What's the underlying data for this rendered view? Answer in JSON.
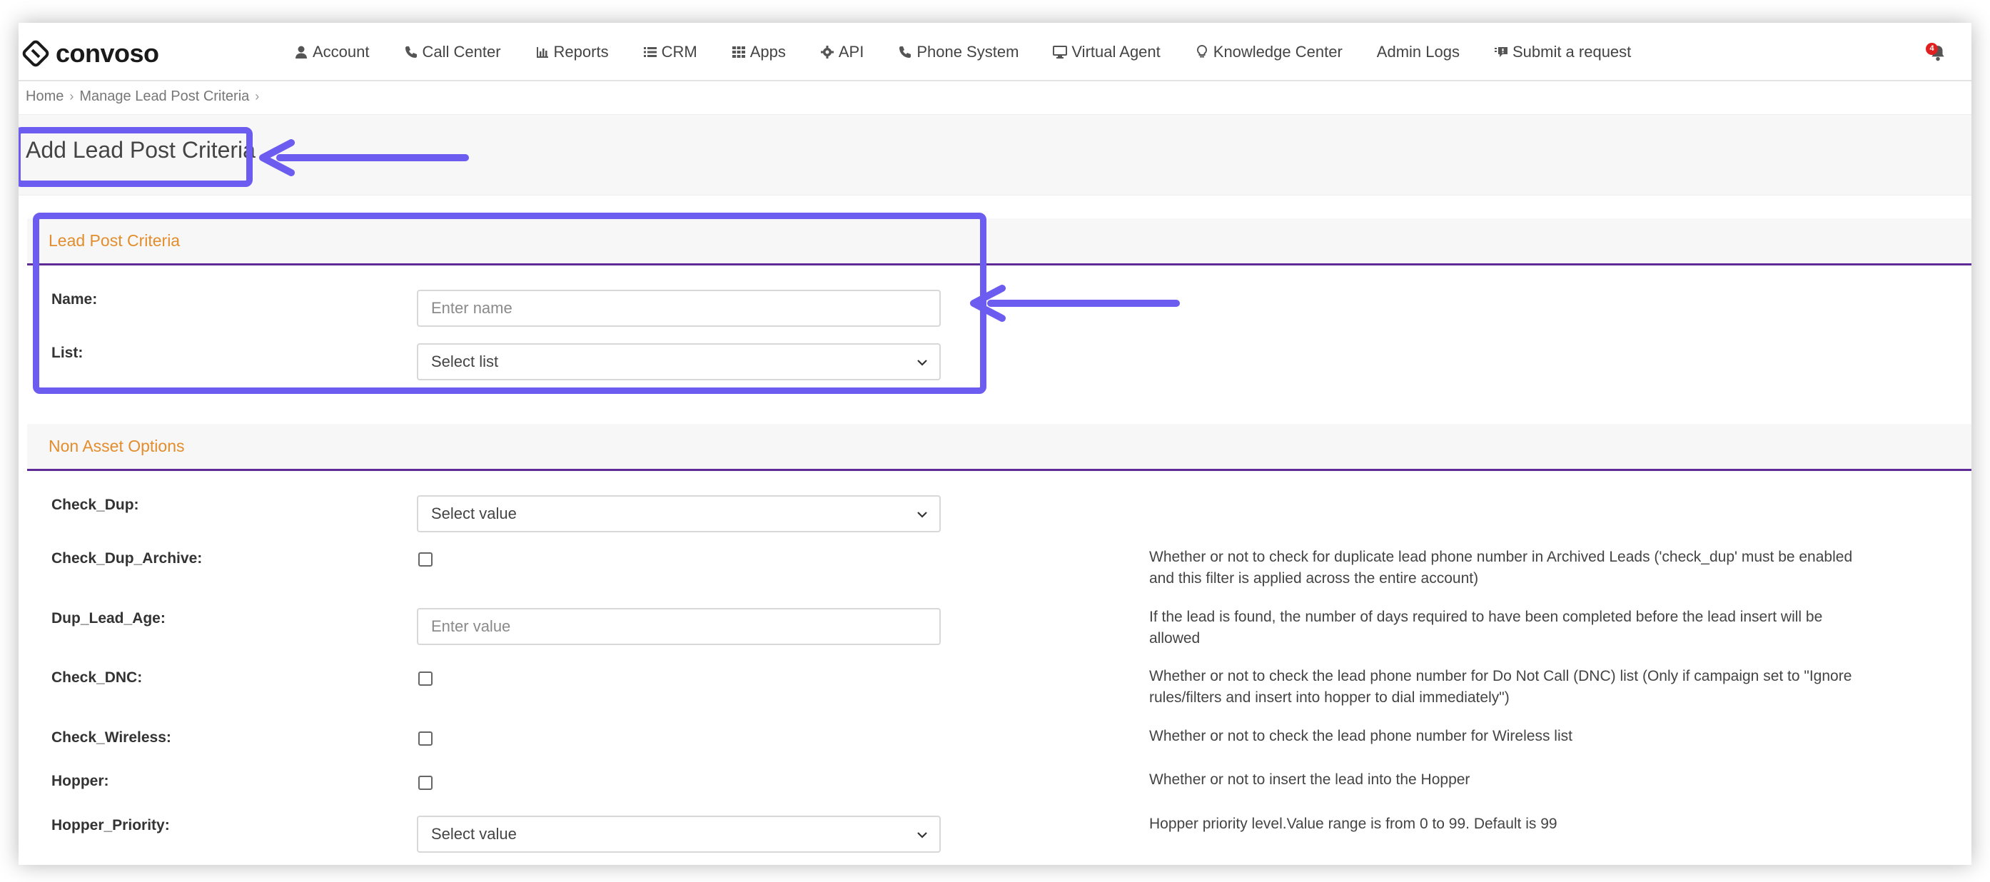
{
  "brand": {
    "name": "convoso"
  },
  "nav": [
    {
      "label": "Account",
      "icon": "user-icon"
    },
    {
      "label": "Call Center",
      "icon": "phone-icon"
    },
    {
      "label": "Reports",
      "icon": "bar-chart-icon"
    },
    {
      "label": "CRM",
      "icon": "list-icon"
    },
    {
      "label": "Apps",
      "icon": "grid-icon"
    },
    {
      "label": "API",
      "icon": "gear-icon"
    },
    {
      "label": "Phone System",
      "icon": "phone-icon"
    },
    {
      "label": "Virtual Agent",
      "icon": "monitor-icon"
    },
    {
      "label": "Knowledge Center",
      "icon": "lightbulb-icon"
    },
    {
      "label": "Admin Logs",
      "icon": ""
    },
    {
      "label": "Submit a request",
      "icon": "chat-icon"
    }
  ],
  "notification": {
    "count": "4"
  },
  "breadcrumb": {
    "home": "Home",
    "current": "Manage Lead Post Criteria"
  },
  "page": {
    "title": "Add Lead Post Criteria"
  },
  "section1": {
    "title": "Lead Post Criteria",
    "name_label": "Name:",
    "name_placeholder": "Enter name",
    "list_label": "List:",
    "list_value": "Select list"
  },
  "section2": {
    "title": "Non Asset Options",
    "fields": [
      {
        "label": "Check_Dup:",
        "type": "select",
        "value": "Select value",
        "desc": ""
      },
      {
        "label": "Check_Dup_Archive:",
        "type": "checkbox",
        "value": "",
        "desc": "Whether or not to check for duplicate lead phone number in Archived Leads ('check_dup' must be enabled and this filter is applied across the entire account)"
      },
      {
        "label": "Dup_Lead_Age:",
        "type": "input",
        "value": "Enter value",
        "desc": "If the lead is found, the number of days required to have been completed before the lead insert will be allowed"
      },
      {
        "label": "Check_DNC:",
        "type": "checkbox",
        "value": "",
        "desc": "Whether or not to check the lead phone number for Do Not Call (DNC) list (Only if campaign set to \"Ignore rules/filters and insert into hopper to dial immediately\")"
      },
      {
        "label": "Check_Wireless:",
        "type": "checkbox",
        "value": "",
        "desc": "Whether or not to check the lead phone number for Wireless list"
      },
      {
        "label": "Hopper:",
        "type": "checkbox",
        "value": "",
        "desc": "Whether or not to insert the lead into the Hopper"
      },
      {
        "label": "Hopper_Priority:",
        "type": "select",
        "value": "Select value",
        "desc": "Hopper priority level.Value range is from 0 to 99. Default is 99"
      }
    ]
  },
  "colors": {
    "accent": "#e38d2c",
    "divider": "#5e2b97",
    "annotation": "#6d5cf0"
  }
}
